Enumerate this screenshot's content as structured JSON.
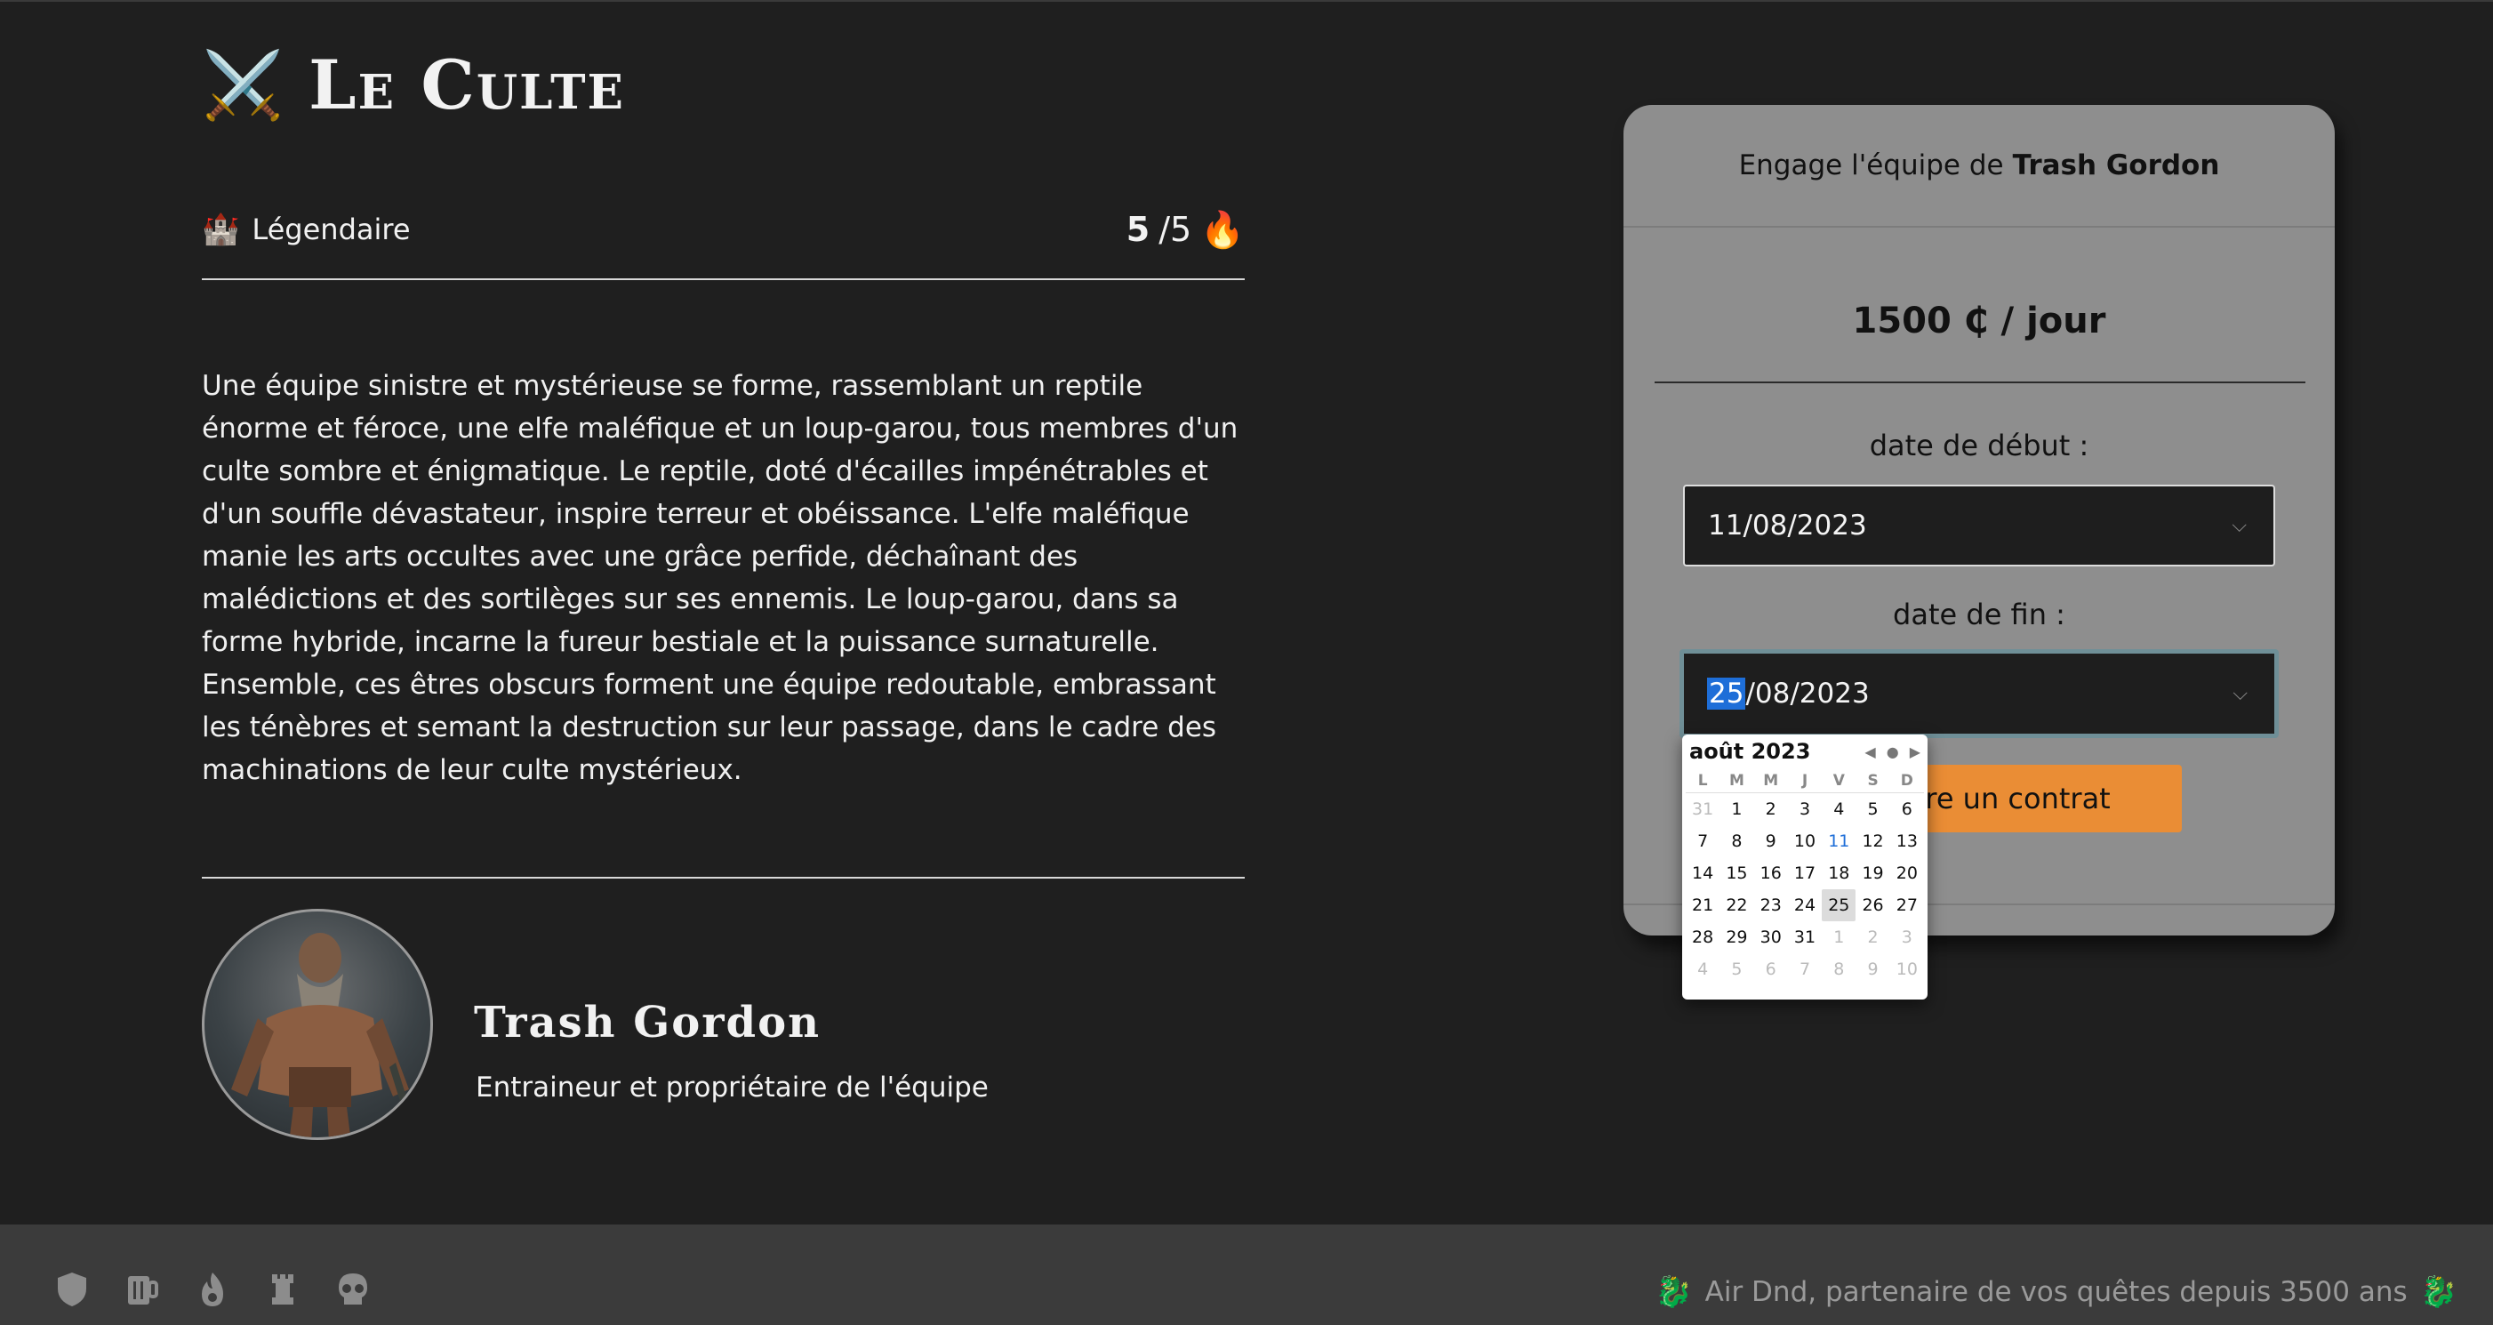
{
  "team": {
    "icon": "crossed-swords-icon",
    "name": "Le Culte",
    "level_icon": "castle-icon",
    "level": "Légendaire",
    "rating": "5",
    "rating_max": "/5",
    "rating_icon": "fire-icon",
    "description": "Une équipe sinistre et mystérieuse se forme, rassemblant un reptile énorme et féroce, une elfe maléfique et un loup-garou, tous membres d'un culte sombre et énigmatique. Le reptile, doté d'écailles impénétrables et d'un souffle dévastateur, inspire terreur et obéissance. L'elfe maléfique manie les arts occultes avec une grâce perfide, déchaînant des malédictions et des sortilèges sur ses ennemis. Le loup-garou, dans sa forme hybride, incarne la fureur bestiale et la puissance surnaturelle. Ensemble, ces êtres obscurs forment une équipe redoutable, embrassant les ténèbres et semant la destruction sur leur passage, dans le cadre des machinations de leur culte mystérieux."
  },
  "owner": {
    "name": "Trash Gordon",
    "role": "Entraineur et propriétaire de l'équipe"
  },
  "booking": {
    "header_prefix": "Engage l'équipe de",
    "header_owner": "Trash Gordon",
    "price": "1500 ₵ / jour",
    "start_label": "date de début :",
    "start_value": "11/08/2023",
    "end_label": "date de fin :",
    "end_day": "25",
    "end_rest": "/08/2023",
    "button_label": "Soumettre un contrat",
    "button_visible_label": "ttre un contrat"
  },
  "calendar": {
    "month": "août 2023",
    "weekdays": [
      "L",
      "M",
      "M",
      "J",
      "V",
      "S",
      "D"
    ],
    "days": [
      "31",
      "1",
      "2",
      "3",
      "4",
      "5",
      "6",
      "7",
      "8",
      "9",
      "10",
      "11",
      "12",
      "13",
      "14",
      "15",
      "16",
      "17",
      "18",
      "19",
      "20",
      "21",
      "22",
      "23",
      "24",
      "25",
      "26",
      "27",
      "28",
      "29",
      "30",
      "31",
      "1",
      "2",
      "3",
      "4",
      "5",
      "6",
      "7",
      "8",
      "9",
      "10"
    ],
    "muted_indices": [
      0,
      32,
      33,
      34,
      35,
      36,
      37,
      38,
      39,
      40,
      41
    ],
    "today_index": 11,
    "selected_index": 25
  },
  "footer": {
    "icons": [
      "shield-icon",
      "beer-mug-icon",
      "fire-icon",
      "rook-icon",
      "skull-icon"
    ],
    "tagline": "Air Dnd, partenaire de vos quêtes depuis 3500 ans",
    "dragon_icon": "dragon-icon"
  },
  "colors": {
    "background": "#1f1f1f",
    "card": "#8e8e8e",
    "accent": "#ea8d35",
    "selection": "#1e6ed8",
    "footer": "#3b3b3b"
  }
}
